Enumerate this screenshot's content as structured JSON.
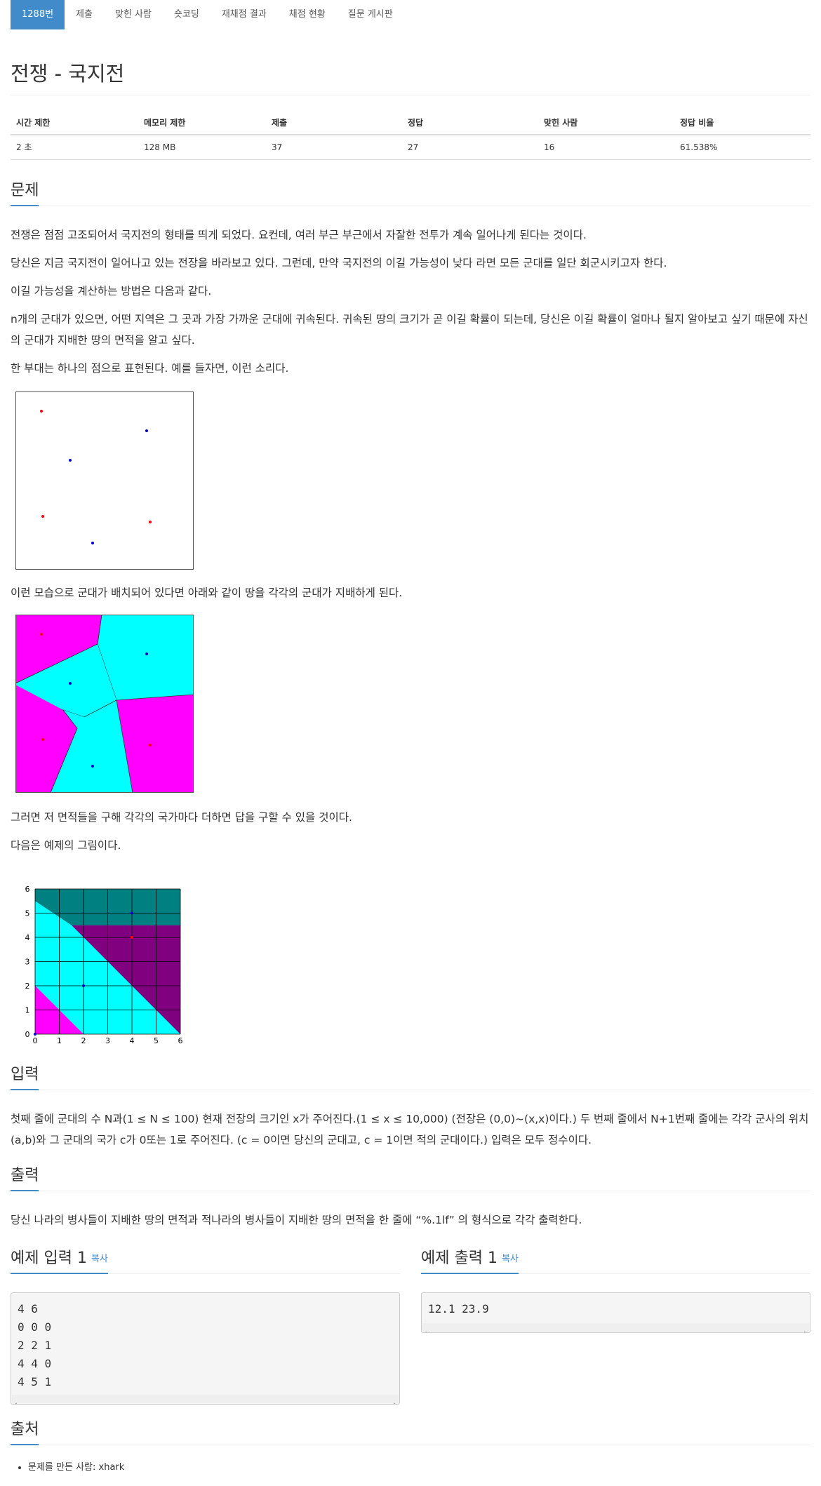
{
  "nav": {
    "tabs": [
      {
        "label": "1288번",
        "active": true
      },
      {
        "label": "제출"
      },
      {
        "label": "맞힌 사람"
      },
      {
        "label": "숏코딩"
      },
      {
        "label": "재채점 결과"
      },
      {
        "label": "채점 현황"
      },
      {
        "label": "질문 게시판"
      }
    ]
  },
  "problem": {
    "title": "전쟁 - 국지전",
    "info_headers": [
      "시간 제한",
      "메모리 제한",
      "제출",
      "정답",
      "맞힌 사람",
      "정답 비율"
    ],
    "info_values": [
      "2 초",
      "128 MB",
      "37",
      "27",
      "16",
      "61.538%"
    ]
  },
  "sections": {
    "problem": "문제",
    "input": "입력",
    "output": "출력",
    "sample_input": "예제 입력 1",
    "sample_output": "예제 출력 1",
    "copy": "복사",
    "source": "출처"
  },
  "text": {
    "p1": "전쟁은 점점 고조되어서 국지전의 형태를 띄게 되었다. 요컨데, 여러 부근 부근에서 자잘한 전투가 계속 일어나게 된다는 것이다.",
    "p2": "당신은 지금 국지전이 일어나고 있는 전장을 바라보고 있다. 그런데, 만약 국지전의 이길 가능성이 낮다 라면 모든 군대를 일단 회군시키고자 한다.",
    "p3": "이길 가능성을 계산하는 방법은 다음과 같다.",
    "p4": "n개의 군대가 있으면, 어떤 지역은 그 곳과 가장 가까운 군대에 귀속된다. 귀속된 땅의 크기가 곧 이길 확률이 되는데, 당신은 이길 확률이 얼마나 될지 알아보고 싶기 때문에 자신의 군대가 지배한 땅의 면적을 알고 싶다.",
    "p5": "한 부대는 하나의 점으로 표현된다. 예를 들자면, 이런 소리다.",
    "p6": "이런 모습으로 군대가 배치되어 있다면 아래와  같이 땅을 각각의 군대가 지배하게 된다.",
    "p7": "그러면 저 면적들을 구해 각각의 국가마다 더하면 답을 구할 수 있을 것이다.",
    "p8": "다음은 예제의 그림이다.",
    "input": "첫째 줄에 군대의 수 N과(1 ≤ N ≤ 100) 현재 전장의 크기인 x가 주어진다.(1 ≤ x ≤ 10,000) (전장은 (0,0)~(x,x)이다.) 두 번째 줄에서 N+1번째 줄에는 각각 군사의 위치 (a,b)와 그 군대의 국가 c가 0또는 1로 주어진다. (c = 0이면 당신의 군대고, c = 1이면 적의 군대이다.) 입력은 모두 정수이다.",
    "output": "당신 나라의 병사들이 지배한 땅의 면적과 적나라의 병사들이 지배한 땅의 면적을 한 줄에 “%.1lf” 의 형식으로 각각 출력한다."
  },
  "samples": {
    "input": "4 6\n0 0 0\n2 2 1\n4 4 0\n4 5 1",
    "output": "12.1 23.9"
  },
  "source": {
    "label": "문제를 만든 사람:",
    "author": "xhark"
  },
  "figure3": {
    "x_ticks": [
      "0",
      "1",
      "2",
      "3",
      "4",
      "5",
      "6"
    ],
    "y_ticks": [
      "0",
      "1",
      "2",
      "3",
      "4",
      "5",
      "6"
    ]
  },
  "colors": {
    "accent": "#428bca",
    "magenta": "#ff00ff",
    "cyan": "#00ffff",
    "teal": "#008080",
    "purple": "#800080"
  }
}
